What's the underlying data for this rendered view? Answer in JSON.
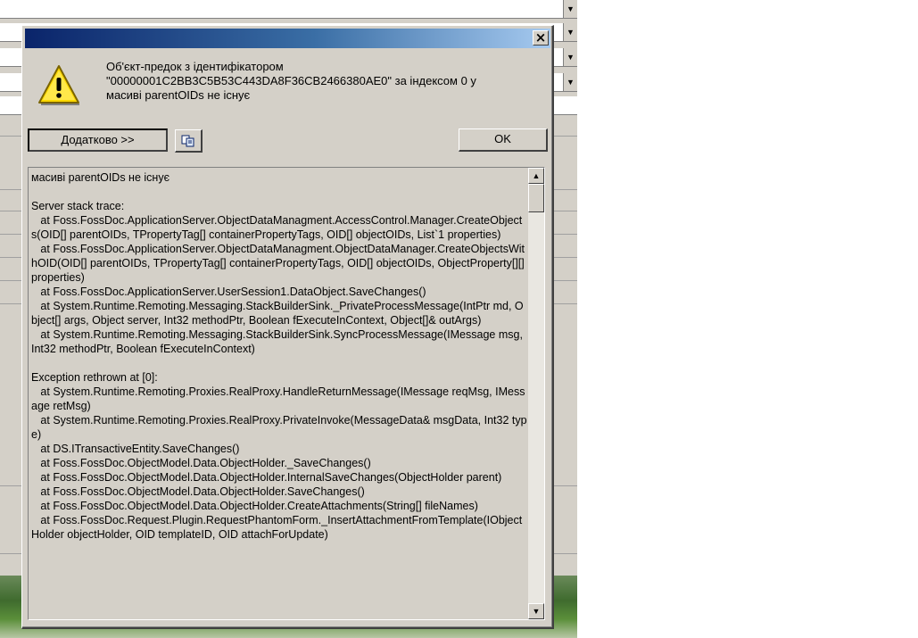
{
  "dialog": {
    "message": "Об'єкт-предок з ідентифікатором\n\"00000001C2BB3C5B53C443DA8F36CB2466380AE0\" за індексом 0 у\nмасиві parentOIDs не існує",
    "more_label": "Додатково >>",
    "ok_label": "OK",
    "close_glyph": "×",
    "icons": {
      "warning": "warning-icon",
      "copy": "copy-icon",
      "close": "close-icon"
    },
    "details": "масиві parentOIDs не існує\n\nServer stack trace:\n   at Foss.FossDoc.ApplicationServer.ObjectDataManagment.AccessControl.Manager.CreateObjects(OID[] parentOIDs, TPropertyTag[] containerPropertyTags, OID[] objectOIDs, List`1 properties)\n   at Foss.FossDoc.ApplicationServer.ObjectDataManagment.ObjectDataManager.CreateObjectsWithOID(OID[] parentOIDs, TPropertyTag[] containerPropertyTags, OID[] objectOIDs, ObjectProperty[][] properties)\n   at Foss.FossDoc.ApplicationServer.UserSession1.DataObject.SaveChanges()\n   at System.Runtime.Remoting.Messaging.StackBuilderSink._PrivateProcessMessage(IntPtr md, Object[] args, Object server, Int32 methodPtr, Boolean fExecuteInContext, Object[]& outArgs)\n   at System.Runtime.Remoting.Messaging.StackBuilderSink.SyncProcessMessage(IMessage msg, Int32 methodPtr, Boolean fExecuteInContext)\n\nException rethrown at [0]:\n   at System.Runtime.Remoting.Proxies.RealProxy.HandleReturnMessage(IMessage reqMsg, IMessage retMsg)\n   at System.Runtime.Remoting.Proxies.RealProxy.PrivateInvoke(MessageData& msgData, Int32 type)\n   at DS.ITransactiveEntity.SaveChanges()\n   at Foss.FossDoc.ObjectModel.Data.ObjectHolder._SaveChanges()\n   at Foss.FossDoc.ObjectModel.Data.ObjectHolder.InternalSaveChanges(ObjectHolder parent)\n   at Foss.FossDoc.ObjectModel.Data.ObjectHolder.SaveChanges()\n   at Foss.FossDoc.ObjectModel.Data.ObjectHolder.CreateAttachments(String[] fileNames)\n   at Foss.FossDoc.Request.Plugin.RequestPhantomForm._InsertAttachmentFromTemplate(IObjectHolder objectHolder, OID templateID, OID attachForUpdate)"
  },
  "colors": {
    "title_start": "#0a246a",
    "title_end": "#a6caf0",
    "face": "#d4d0c8",
    "warning_yellow": "#ffd800"
  }
}
